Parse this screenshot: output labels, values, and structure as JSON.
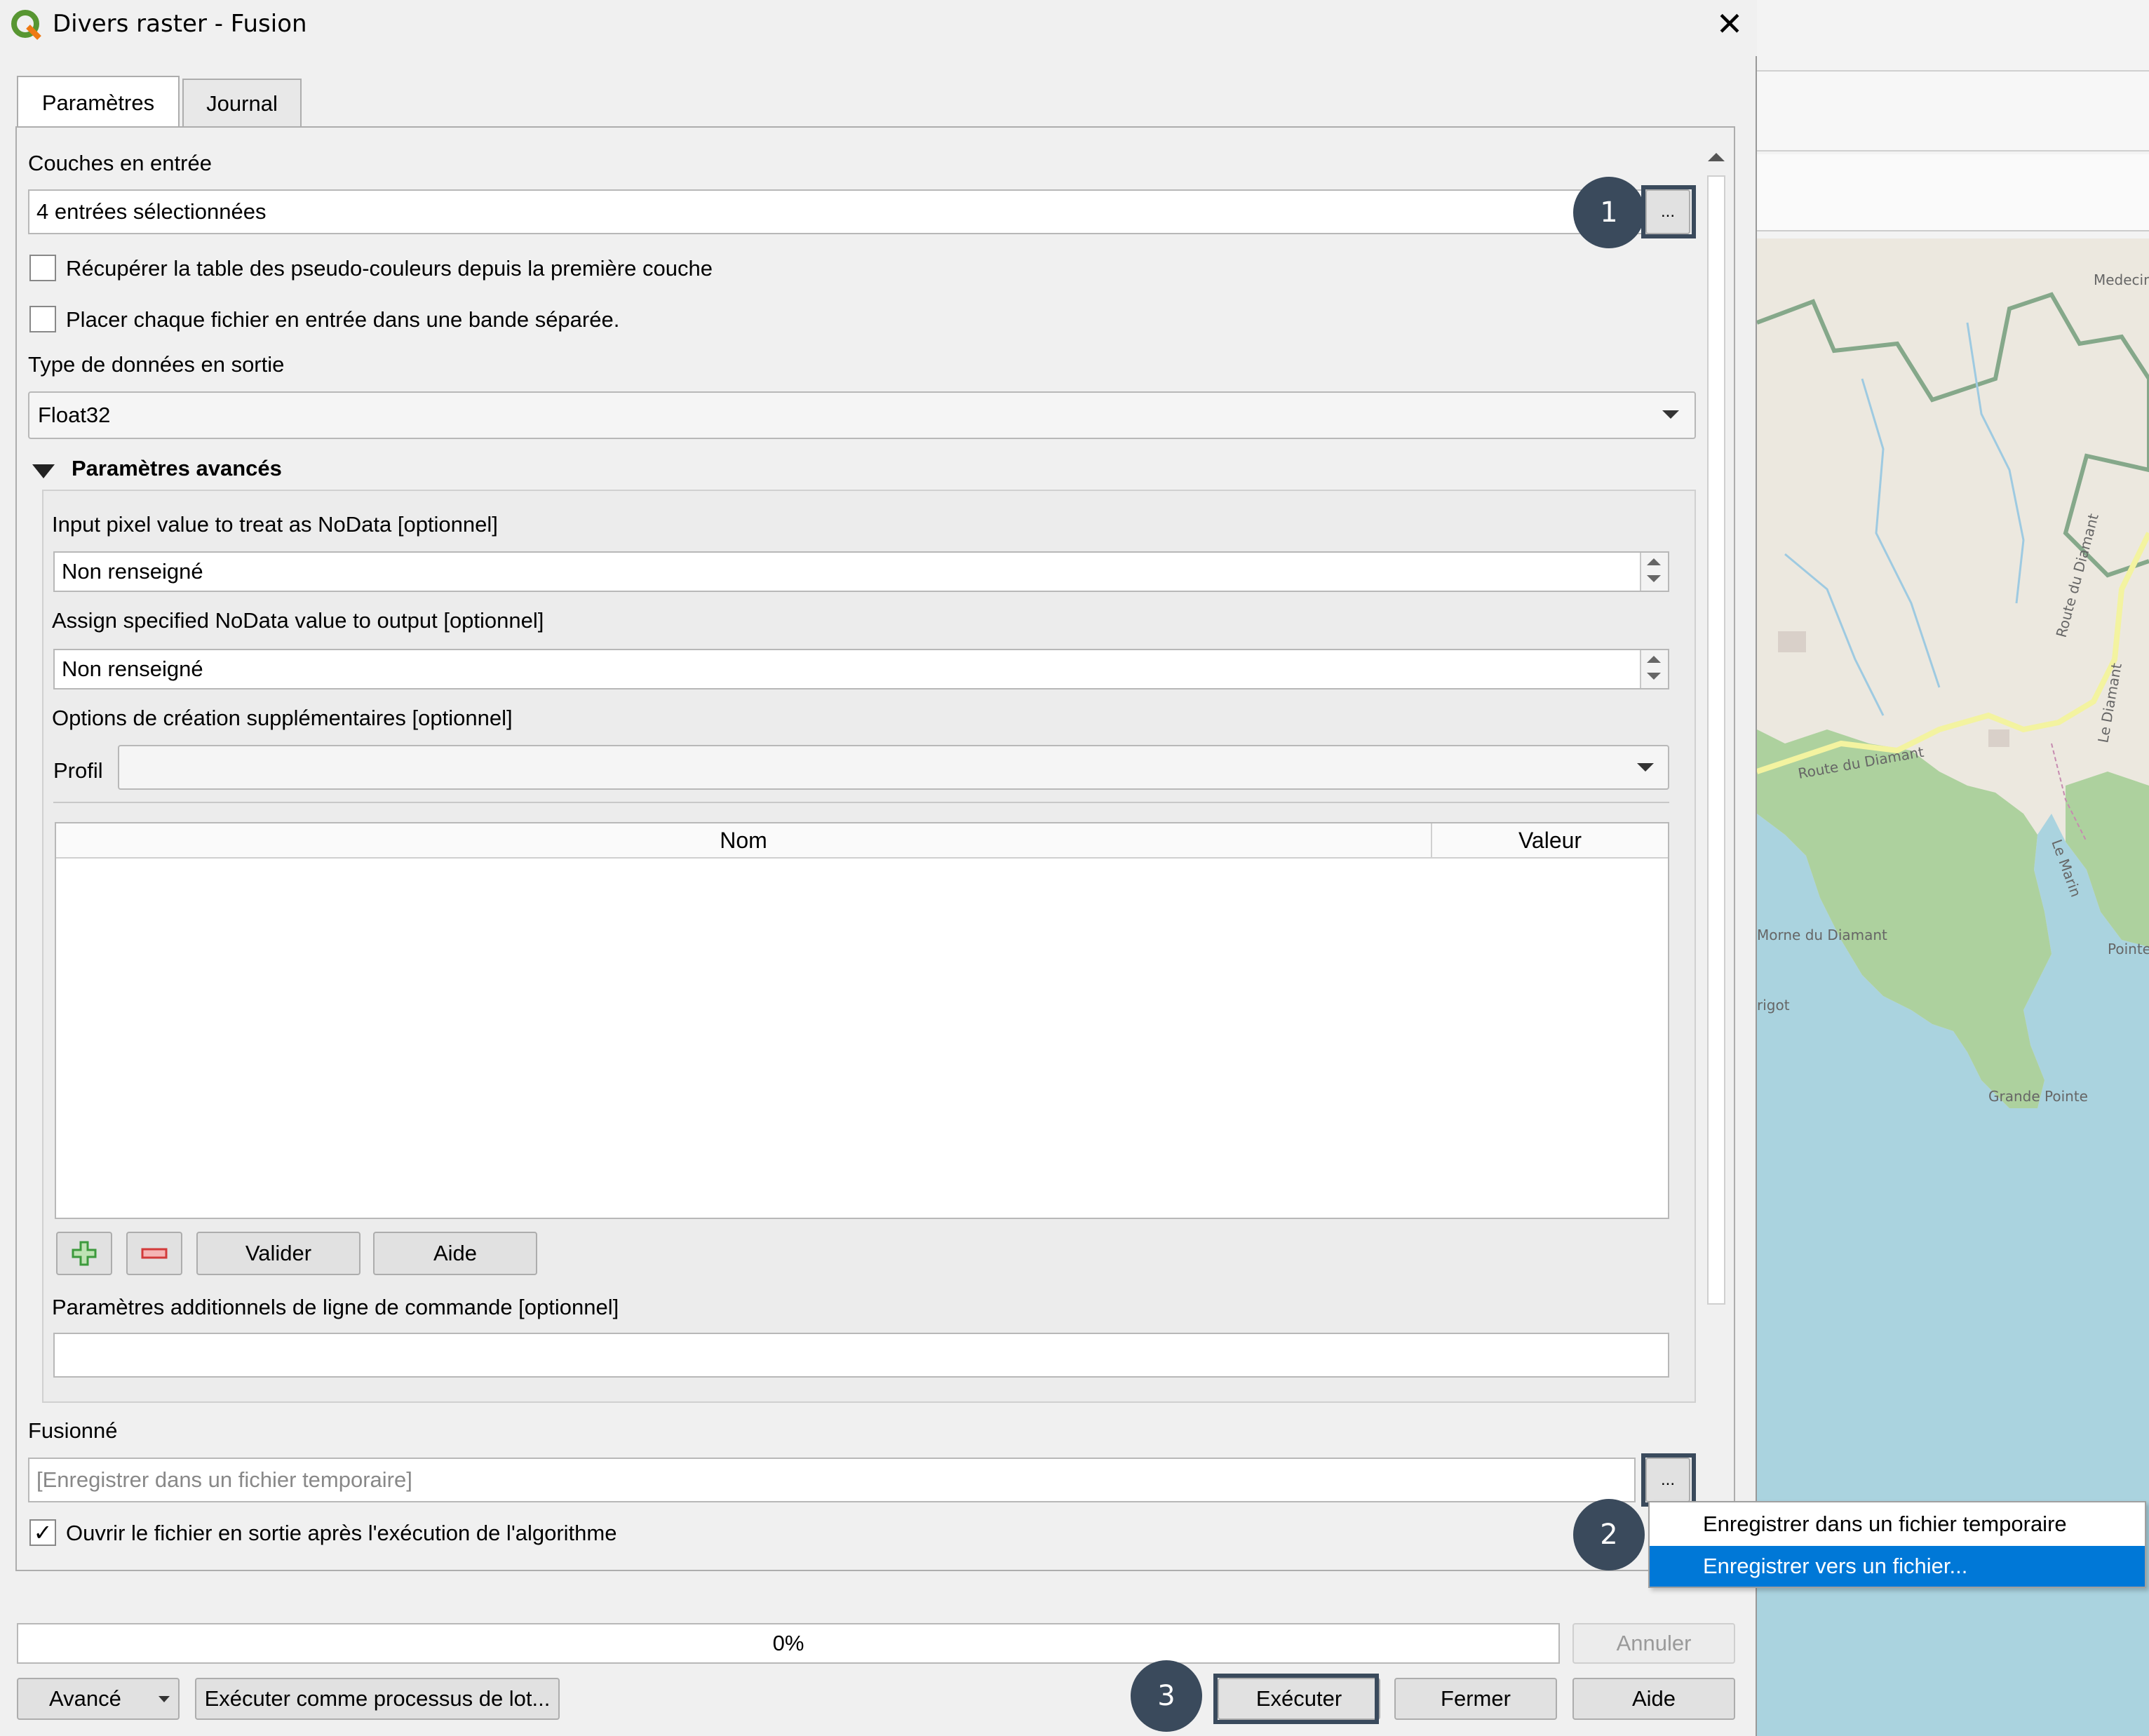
{
  "window": {
    "title": "Divers raster - Fusion",
    "close_glyph": "✕"
  },
  "tabs": [
    {
      "label": "Paramètres"
    },
    {
      "label": "Journal"
    }
  ],
  "params": {
    "input_layers_label": "Couches en entrée",
    "input_layers_value": "4 entrées sélectionnées",
    "ellipsis": "...",
    "pseudocolor_label": "Récupérer la table des pseudo-couleurs depuis la première couche",
    "separate_band_label": "Placer chaque fichier en entrée dans une bande séparée.",
    "output_type_label": "Type de données en sortie",
    "output_type_value": "Float32",
    "advanced_header": "Paramètres avancés",
    "input_nodata_label": "Input pixel value to treat as NoData [optionnel]",
    "input_nodata_value": "Non renseigné",
    "assign_nodata_label": "Assign specified NoData value to output [optionnel]",
    "assign_nodata_value": "Non renseigné",
    "creation_options_label": "Options de création supplémentaires [optionnel]",
    "profile_label": "Profil",
    "profile_value": "",
    "table_headers": [
      "Nom",
      "Valeur"
    ],
    "validate_button": "Valider",
    "help_button": "Aide",
    "extra_cmd_label": "Paramètres additionnels de ligne de commande [optionnel]",
    "extra_cmd_value": "",
    "merged_label": "Fusionné",
    "merged_placeholder": "[Enregistrer dans un fichier temporaire]",
    "open_output_label": "Ouvrir le fichier en sortie après l'exécution de l'algorithme",
    "open_output_checked": true
  },
  "dropdown_menu": {
    "items": [
      "Enregistrer dans un fichier temporaire",
      "Enregistrer vers un fichier..."
    ],
    "selected_index": 1,
    "selected_color": "#0078d7"
  },
  "progress": {
    "value": 0,
    "text": "0%"
  },
  "footer": {
    "cancel": "Annuler",
    "advanced": "Avancé",
    "batch": "Exécuter comme processus de lot...",
    "run": "Exécuter",
    "close": "Fermer",
    "help": "Aide"
  },
  "badges": [
    "1",
    "2",
    "3"
  ],
  "map_labels": [
    "Medecin",
    "Route du Diamant",
    "Le Marin",
    "Route du Diamant",
    "Le Diamant",
    "Morne du Diamant",
    "Grande Pointe",
    "Pointe Giraud",
    "rigot"
  ],
  "icons": {
    "qgis": "qgis-logo-icon",
    "add": "plus-icon",
    "remove": "minus-icon",
    "collapse": "triangle-down-icon"
  }
}
